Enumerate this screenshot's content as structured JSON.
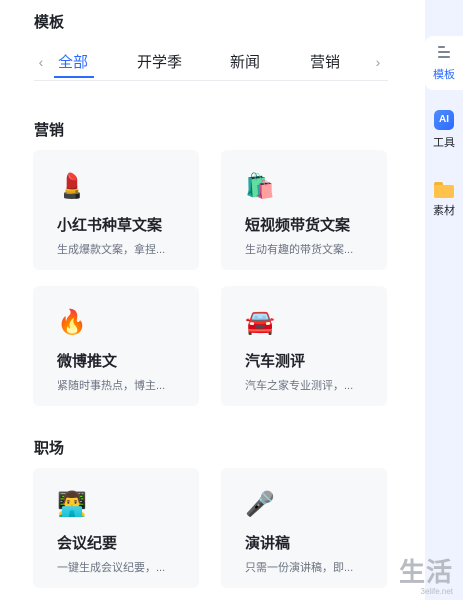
{
  "header": {
    "title": "模板"
  },
  "tabs": {
    "items": [
      {
        "label": "全部",
        "active": true
      },
      {
        "label": "开学季",
        "active": false
      },
      {
        "label": "新闻",
        "active": false
      },
      {
        "label": "营销",
        "active": false
      }
    ],
    "prev_arrow": "‹",
    "next_arrow": "›"
  },
  "sections": [
    {
      "title": "营销",
      "cards": [
        {
          "icon": "lipstick-icon",
          "emoji": "💄",
          "name": "小红书种草文案",
          "desc": "生成爆款文案，拿捏..."
        },
        {
          "icon": "shopping-bags-icon",
          "emoji": "🛍️",
          "name": "短视频带货文案",
          "desc": "生动有趣的带货文案..."
        },
        {
          "icon": "fire-icon",
          "emoji": "🔥",
          "name": "微博推文",
          "desc": "紧随时事热点，博主..."
        },
        {
          "icon": "car-icon",
          "emoji": "🚘",
          "name": "汽车测评",
          "desc": "汽车之家专业测评，..."
        }
      ]
    },
    {
      "title": "职场",
      "cards": [
        {
          "icon": "laptop-person-icon",
          "emoji": "👨‍💻",
          "name": "会议纪要",
          "desc": "一键生成会议纪要，..."
        },
        {
          "icon": "microphone-icon",
          "emoji": "🎤",
          "name": "演讲稿",
          "desc": "只需一份演讲稿，即..."
        }
      ]
    }
  ],
  "sidebar": {
    "items": [
      {
        "label": "模板",
        "icon": "template-icon",
        "active": true
      },
      {
        "label": "工具",
        "icon": "ai-tool-icon",
        "icon_text": "AI",
        "active": false
      },
      {
        "label": "素材",
        "icon": "folder-icon",
        "active": false
      }
    ]
  },
  "watermark": {
    "text": "生活",
    "sub": "3elife.net"
  },
  "colors": {
    "accent": "#2b6bff",
    "card_bg": "#f7f8fa",
    "sidebar_bg": "#eef3ff"
  }
}
